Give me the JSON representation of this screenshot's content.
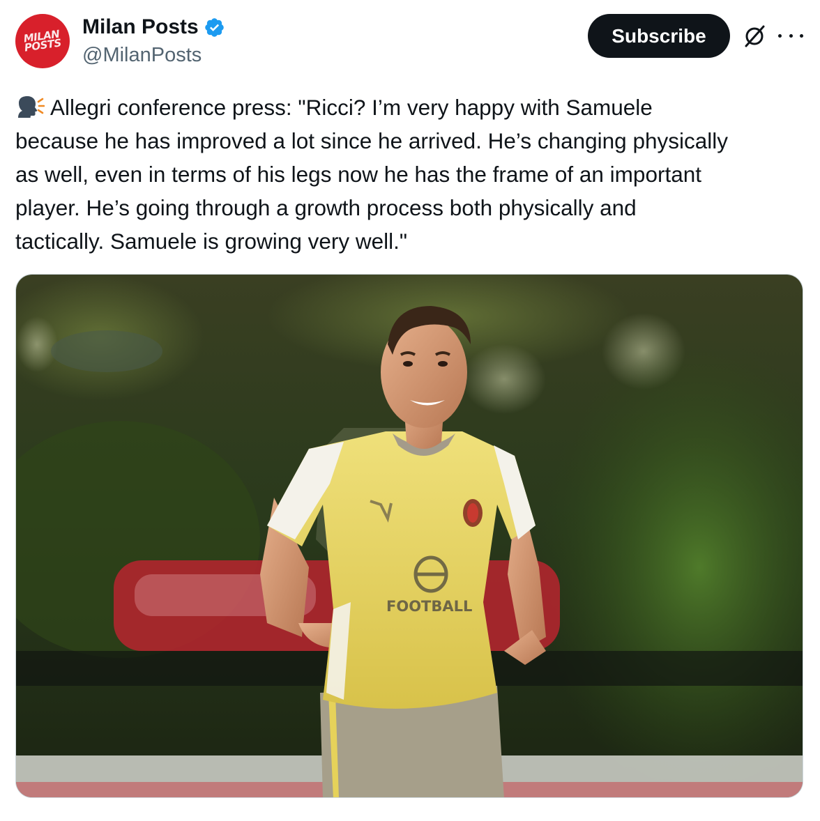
{
  "account": {
    "display_name": "Milan Posts",
    "handle": "@MilanPosts",
    "avatar_text": "MILAN POSTS",
    "avatar_color": "#d8202b",
    "verified": true,
    "verified_color": "#1d9bf0"
  },
  "actions": {
    "subscribe_label": "Subscribe",
    "grok_icon": "grok-icon",
    "more_icon": "more-icon"
  },
  "tweet": {
    "emoji": "speaking-head",
    "lines": [
      "Allegri conference press: \"Ricci? I’m very happy with Samuele",
      "because he has improved a lot since he arrived. He’s changing physically",
      "as well, even in terms of his legs now he has the frame of an important",
      "player. He’s going through a growth process both physically and",
      "tactically. Samuele is growing very well.\""
    ]
  },
  "media": {
    "shirt_sponsor": "FOOTBALL"
  }
}
